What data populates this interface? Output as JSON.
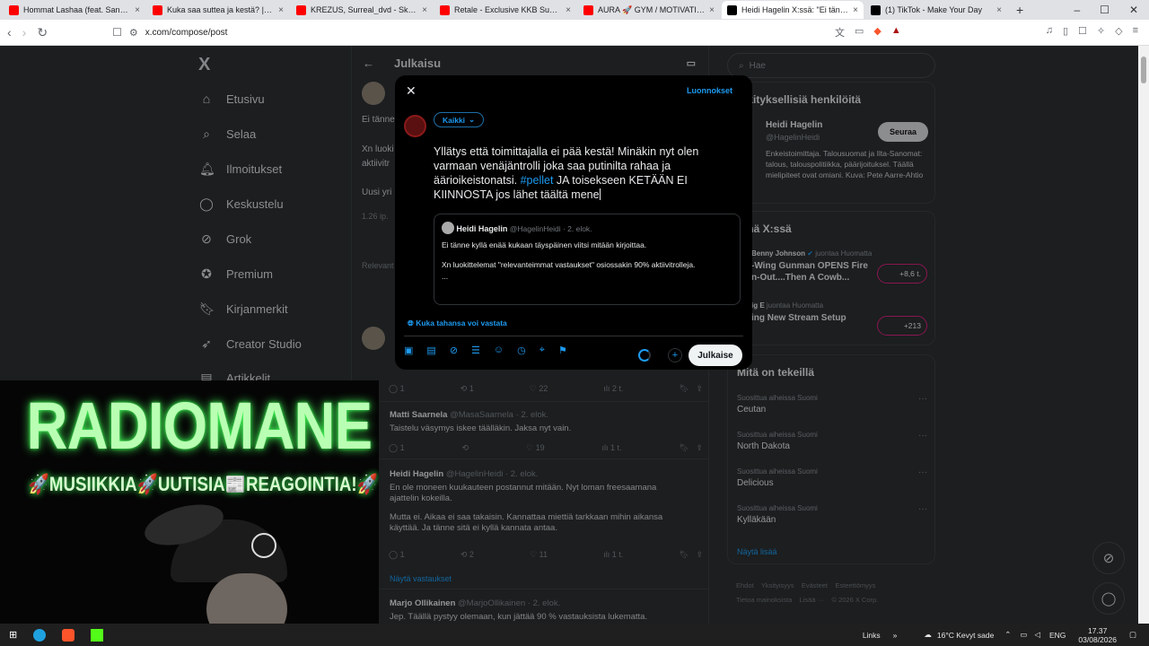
{
  "tabs": [
    {
      "title": "Hommat Lashaa (feat. Sanes T) - Yo",
      "fav": "#ff0000"
    },
    {
      "title": "Kuka saa suttea ja kestä? | Sportiik",
      "fav": "#ff0000"
    },
    {
      "title": "KREZUS, Surreal_dvd - Skins (Ultra S",
      "fav": "#ff0000"
    },
    {
      "title": "Retale - Exclusive KKB Support (w/",
      "fav": "#ff0000"
    },
    {
      "title": "AURA 🚀 GYM / MOTIVATION & E",
      "fav": "#ff0000"
    },
    {
      "title": "Heidi Hagelin X:ssä: \"Ei tänne k",
      "fav": "#000000"
    },
    {
      "title": "(1) TikTok - Make Your Day",
      "fav": "#000000"
    }
  ],
  "new_tab": "+",
  "url": "x.com/compose/post",
  "nav": {
    "logo": "X",
    "items": [
      "Etusivu",
      "Selaa",
      "Ilmoitukset",
      "Keskustelu",
      "Grok",
      "Premium",
      "Kirjanmerkit",
      "Creator Studio",
      "Artikkelit"
    ]
  },
  "center": {
    "title": "Julkaisu",
    "peek": [
      "Ei tänne",
      "Xn luoki aktiivitr",
      "Uusi yri",
      "1.26 ip.",
      "Relevant"
    ],
    "stats_row1": [
      "1",
      "1",
      "22",
      "2 t."
    ],
    "posts": [
      {
        "name": "Matti Saarnela",
        "handle": "@MasaSaarnela · 2. elok.",
        "text": "Taistelu väsymys iskee täälläkin. Jaksa nyt vain.",
        "stats": [
          "1",
          "",
          "19",
          "1 t."
        ]
      },
      {
        "name": "Heidi Hagelin",
        "handle": "@HagelinHeidi · 2. elok.",
        "text": "En ole moneen kuukauteen postannut mitään. Nyt loman freesaamana ajattelin kokeilla.",
        "text2": "Mutta ei. Aikaa ei saa takaisin. Kannattaa miettiä tarkkaan mihin aikansa käyttää. Ja tänne sitä ei kyllä kannata antaa.",
        "stats": [
          "1",
          "2",
          "11",
          "1 t."
        ]
      },
      {
        "name": "Marjo Ollikainen",
        "handle": "@MarjoOllikainen · 2. elok.",
        "text": "Jep. Täällä pystyy olemaan, kun jättää 90 % vastauksista lukematta."
      }
    ],
    "show_replies": "Näytä vastaukset"
  },
  "right": {
    "search": "Hae",
    "who_title": "erkityksellisiä henkilöitä",
    "who_name": "Heidi Hagelin",
    "who_handle": "@HagelinHeidi",
    "follow": "Seuraa",
    "who_bio": "Enkeistoimittaja. Talousuomat ja Ilta-Sanomat: talous, talouspolitiikka, päärijoituksel. Täällä mielipiteet ovat omiani. Kuva: Pete Aarre-Ahtio",
    "live_title": "renä X:ssä",
    "live": [
      {
        "host": "Benny Johnson",
        "sub": "juontaa Huomatta",
        "title1": "-Wing Gunman OPENS Fire",
        "title2": "n-Out....Then A Cowb...",
        "count": "+8,6 t."
      },
      {
        "host": "ig E",
        "sub": "juontaa Huomatta",
        "title1": "ing New Stream Setup",
        "title2": "",
        "count": "+213"
      }
    ],
    "trends_title": "Mitä on tekeillä",
    "trends": [
      {
        "sub": "Suosittua aiheissa Suomi",
        "name": "Ceutan"
      },
      {
        "sub": "Suosittua aiheissa Suomi",
        "name": "North Dakota"
      },
      {
        "sub": "Suosittua aiheissa Suomi",
        "name": "Delicious"
      },
      {
        "sub": "Suosittua aiheissa Suomi",
        "name": "Kylläkään"
      }
    ],
    "show_more": "Näytä lisää",
    "footer1": [
      "Ehdot",
      "Yksityisyys",
      "Evästeet",
      "Esteettömyys"
    ],
    "footer2": [
      "Tietoa mainoksista",
      "Lisää ···",
      "© 2026 X Corp."
    ]
  },
  "dialog": {
    "drafts": "Luonnokset",
    "audience": "Kaikki",
    "compose_a": "Yllätys että toimittajalla ei pää kestä! Minäkin nyt olen varmaan venäjäntrolli joka saa putinilta rahaa ja äärioikeistonatsi.",
    "compose_hash": "#pellet",
    "compose_b": "JA toisekseen KETÄÄN EI KIINNOSTA jos lähet täältä mene",
    "quote_name": "Heidi Hagelin",
    "quote_handle": "@HagelinHeidi · 2. elok.",
    "quote_line1": "Ei tänne kyllä enää kukaan täyspäinen viitsi mitään kirjoittaa.",
    "quote_line2": "Xn luokittelemat \"relevanteimmat vastaukset\" osiossakin 90% aktiivitrolleja.",
    "quote_more": "...",
    "reply_setting": "Kuka tahansa voi vastata",
    "publish": "Julkaise",
    "add": "+"
  },
  "webcam": {
    "title": "RADIOMANE",
    "subtitle": "🚀MUSIIKKIA🚀UUTISIA📰REAGOINTIA!🚀"
  },
  "taskbar": {
    "links": "Links",
    "weather": "16°C  Kevyt sade",
    "lang": "ENG",
    "time": "17.37",
    "date": "03/08/2026"
  }
}
